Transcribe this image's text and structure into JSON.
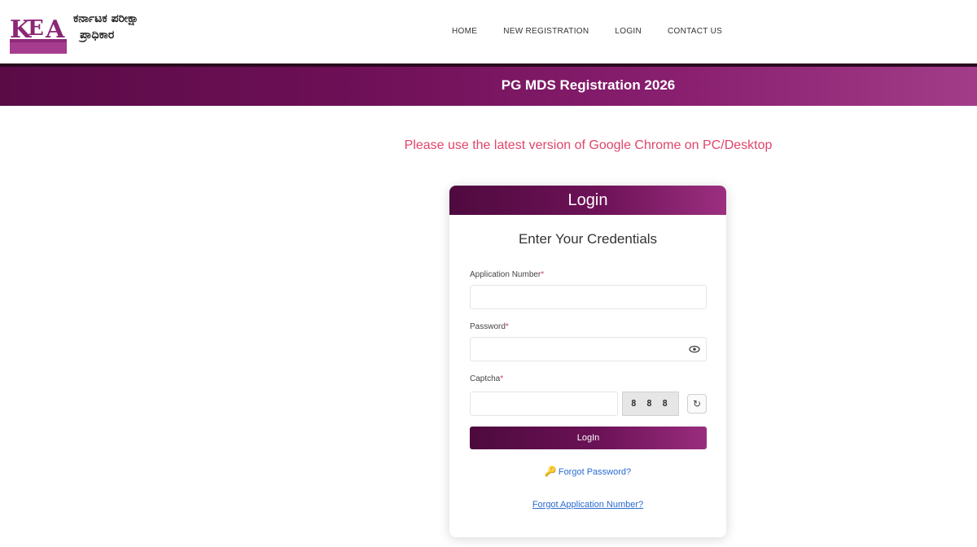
{
  "header": {
    "logo_text_line1": "ಕರ್ನಾಟಕ ಪರೀಕ್ಷಾ",
    "logo_text_line2": "ಪ್ರಾಧಿಕಾರ",
    "nav": [
      "HOME",
      "NEW REGISTRATION",
      "LOGIN",
      "CONTACT US"
    ]
  },
  "banner": {
    "title": "PG MDS Registration 2026"
  },
  "notice": "Please use the latest version of Google Chrome on PC/Desktop",
  "login": {
    "title": "Login",
    "subtitle": "Enter Your Credentials",
    "application_label": "Application Number",
    "password_label": "Password",
    "captcha_label": "Captcha",
    "captcha_value": "8 8 8",
    "submit_label": "LogIn",
    "forgot_label": "Forgot Password?",
    "forgot_app_label": "Forgot Application Number?"
  },
  "colors": {
    "brand": "#6d0f56",
    "notice": "#e0456b",
    "link": "#2a6ad0"
  },
  "icons": {
    "eye": "eye-icon",
    "refresh": "refresh-icon",
    "key": "key-icon"
  }
}
